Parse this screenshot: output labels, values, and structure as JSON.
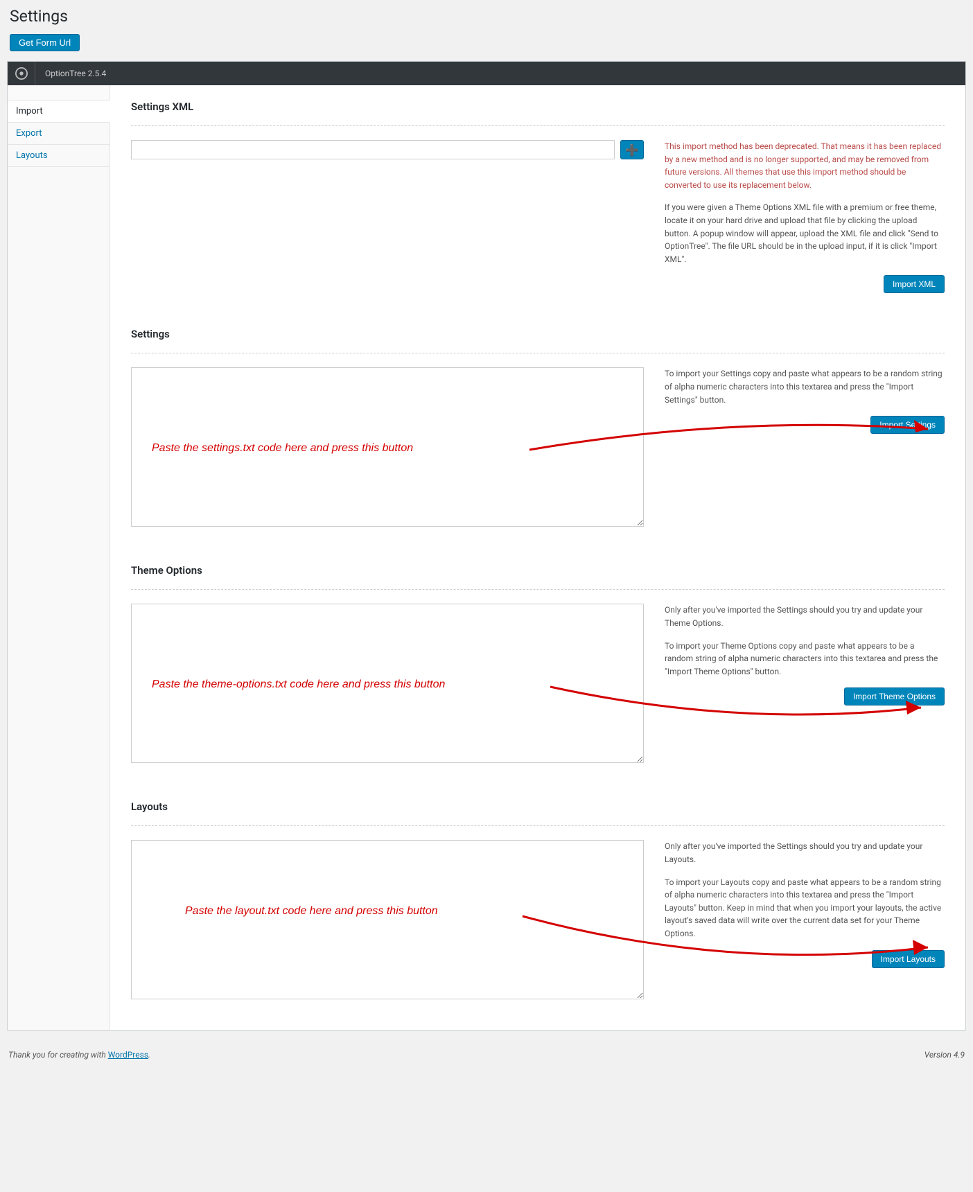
{
  "page": {
    "title": "Settings"
  },
  "buttons": {
    "get_form_url": "Get Form Url"
  },
  "header": {
    "version": "OptionTree 2.5.4"
  },
  "tabs": {
    "import": "Import",
    "export": "Export",
    "layouts": "Layouts"
  },
  "sections": {
    "xml": {
      "title": "Settings XML",
      "warning": "This import method has been deprecated. That means it has been replaced by a new method and is no longer supported, and may be removed from future versions. All themes that use this import method should be converted to use its replacement below.",
      "desc": "If you were given a Theme Options XML file with a premium or free theme, locate it on your hard drive and upload that file by clicking the upload button. A popup window will appear, upload the XML file and click \"Send to OptionTree\". The file URL should be in the upload input, if it is click \"Import XML\".",
      "button": "Import XML"
    },
    "settings": {
      "title": "Settings",
      "desc": "To import your Settings copy and paste what appears to be a random string of alpha numeric characters into this textarea and press the \"Import Settings\" button.",
      "button": "Import Settings",
      "annotation": "Paste the settings.txt code here and press this button"
    },
    "theme": {
      "title": "Theme Options",
      "desc1": "Only after you've imported the Settings should you try and update your Theme Options.",
      "desc2": "To import your Theme Options copy and paste what appears to be a random string of alpha numeric characters into this textarea and press the \"Import Theme Options\" button.",
      "button": "Import Theme Options",
      "annotation": "Paste the theme-options.txt code here and press this button"
    },
    "layouts": {
      "title": "Layouts",
      "desc1": "Only after you've imported the Settings should you try and update your Layouts.",
      "desc2": "To import your Layouts copy and paste what appears to be a random string of alpha numeric characters into this textarea and press the \"Import Layouts\" button. Keep in mind that when you import your layouts, the active layout's saved data will write over the current data set for your Theme Options.",
      "button": "Import Layouts",
      "annotation": "Paste the layout.txt code here and press this button"
    }
  },
  "footer": {
    "credit_prefix": "Thank you for creating with ",
    "credit_link": "WordPress",
    "credit_suffix": ".",
    "version": "Version 4.9"
  }
}
